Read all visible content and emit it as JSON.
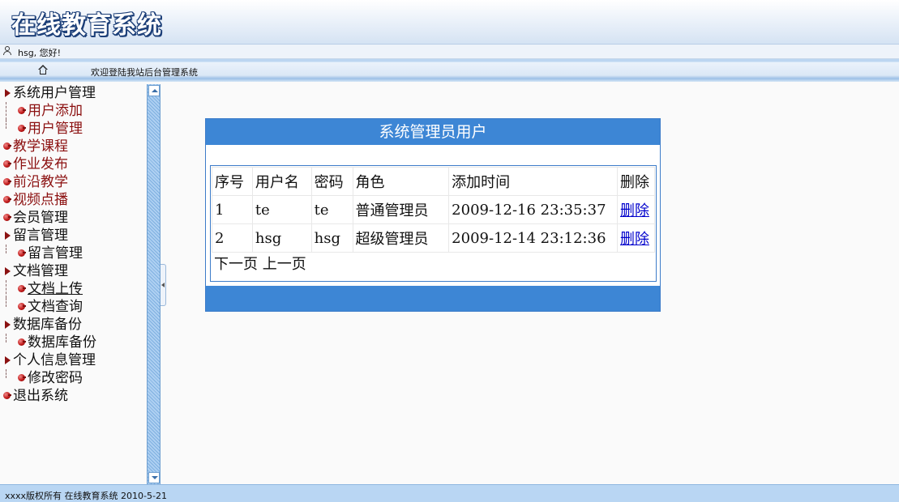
{
  "header": {
    "title": "在线教育系统"
  },
  "greeting": {
    "text": "hsg, 您好!",
    "icon": "user-icon"
  },
  "nav": {
    "home_icon": "home-icon",
    "welcome": "欢迎登陆我站后台管理系统"
  },
  "sidebar": {
    "items": [
      {
        "label": "系统用户管理",
        "type": "group",
        "color": "#111111"
      },
      {
        "label": "用户添加",
        "type": "sub",
        "color": "#8b0f0f"
      },
      {
        "label": "用户管理",
        "type": "sub",
        "color": "#8b0f0f"
      },
      {
        "label": "教学课程",
        "type": "leaf",
        "color": "#8b0f0f"
      },
      {
        "label": "作业发布",
        "type": "leaf",
        "color": "#8b0f0f"
      },
      {
        "label": "前沿教学",
        "type": "leaf",
        "color": "#8b0f0f"
      },
      {
        "label": "视频点播",
        "type": "leaf",
        "color": "#8b0f0f"
      },
      {
        "label": "会员管理",
        "type": "leaf",
        "color": "#111111"
      },
      {
        "label": "留言管理",
        "type": "group",
        "color": "#111111"
      },
      {
        "label": "留言管理",
        "type": "sub",
        "color": "#111111"
      },
      {
        "label": "文档管理",
        "type": "group",
        "color": "#111111"
      },
      {
        "label": "文档上传",
        "type": "sub",
        "color": "#111111"
      },
      {
        "label": "文档查询",
        "type": "sub",
        "color": "#111111"
      },
      {
        "label": "数据库备份",
        "type": "group",
        "color": "#111111"
      },
      {
        "label": "数据库备份",
        "type": "sub",
        "color": "#111111"
      },
      {
        "label": "个人信息管理",
        "type": "group",
        "color": "#111111"
      },
      {
        "label": "修改密码",
        "type": "sub",
        "color": "#111111"
      },
      {
        "label": "退出系统",
        "type": "leaf",
        "color": "#111111"
      }
    ]
  },
  "panel": {
    "title": "系统管理员用户",
    "columns": [
      "序号",
      "用户名",
      "密码",
      "角色",
      "添加时间",
      "删除"
    ],
    "rows": [
      {
        "id": "1",
        "username": "te",
        "password": "te",
        "role": "普通管理员",
        "added": "2009-12-16 23:35:37",
        "delete_label": "删除"
      },
      {
        "id": "2",
        "username": "hsg",
        "password": "hsg",
        "role": "超级管理员",
        "added": "2009-12-14 23:12:36",
        "delete_label": "删除"
      }
    ],
    "pager": {
      "next": "下一页",
      "prev": "上一页"
    }
  },
  "footer": {
    "text": "xxxx版权所有  在线教育系统  2010-5-21"
  },
  "colors": {
    "accent": "#3d86d5",
    "menu_red": "#8b0f0f",
    "footer_bg": "#b9d6f3"
  }
}
